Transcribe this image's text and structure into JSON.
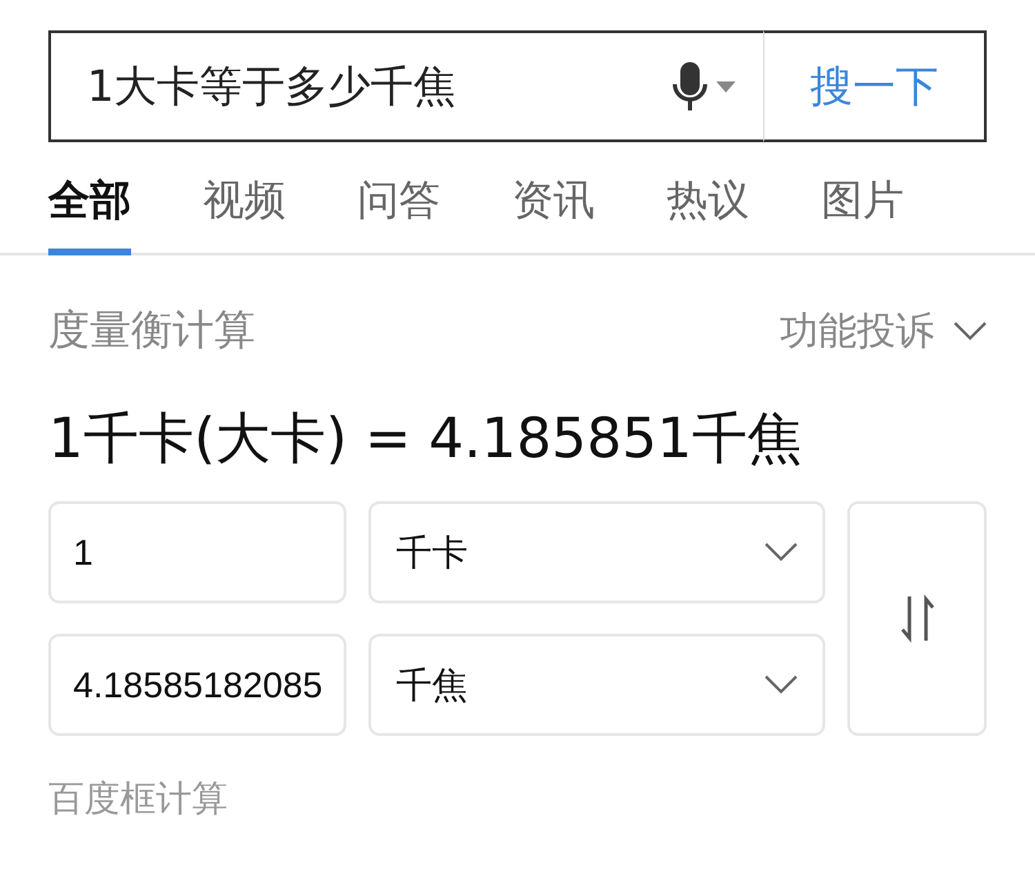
{
  "search": {
    "value": "1大卡等于多少千焦",
    "button": "搜一下"
  },
  "tabs": [
    {
      "label": "全部",
      "selected": true
    },
    {
      "label": "视频",
      "selected": false
    },
    {
      "label": "问答",
      "selected": false
    },
    {
      "label": "资讯",
      "selected": false
    },
    {
      "label": "热议",
      "selected": false
    },
    {
      "label": "图片",
      "selected": false
    }
  ],
  "card": {
    "title": "度量衡计算",
    "feedback": "功能投诉",
    "result": "1千卡(大卡) = 4.185851千焦",
    "rows": [
      {
        "value": "1",
        "unit": "千卡"
      },
      {
        "value": "4.18585182085",
        "unit": "千焦"
      }
    ],
    "footer": "百度框计算"
  }
}
